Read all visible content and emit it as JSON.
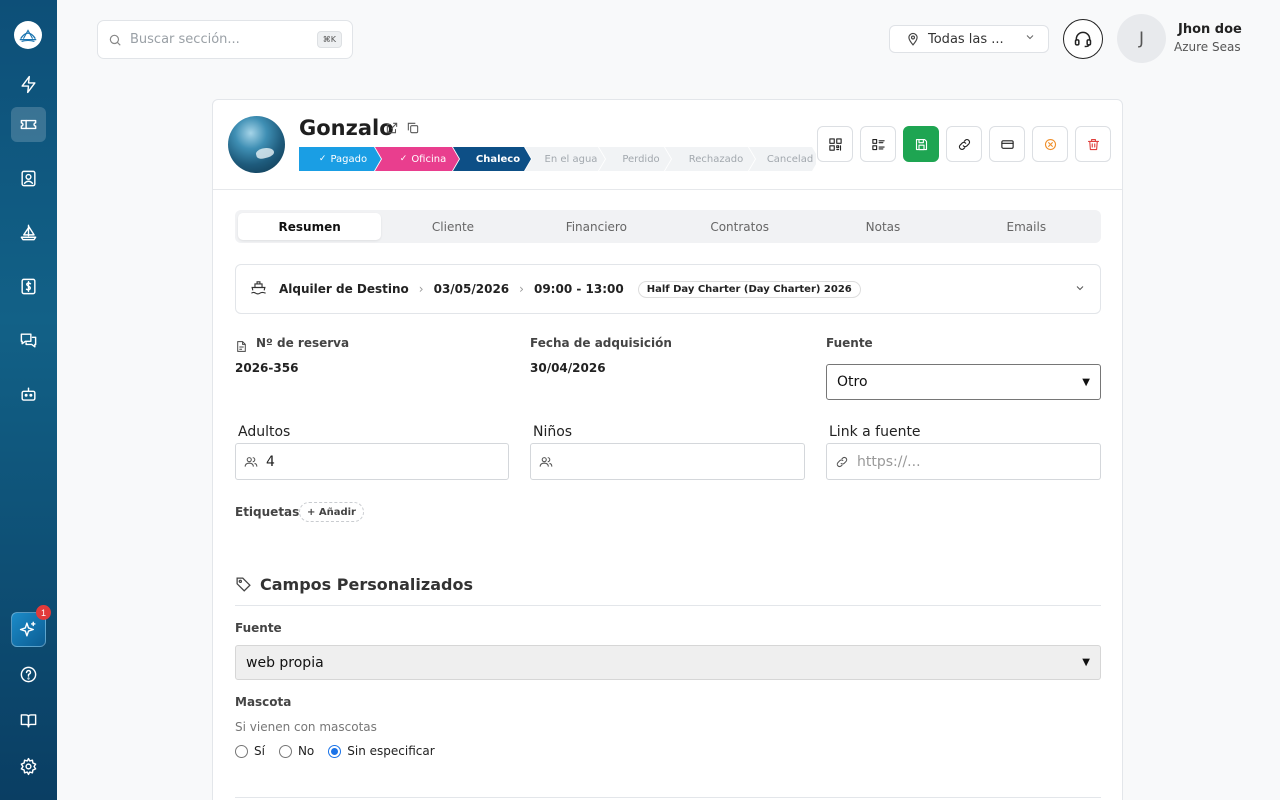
{
  "search": {
    "placeholder": "Buscar sección...",
    "shortcut": "⌘K"
  },
  "location": {
    "label": "Todas las ..."
  },
  "user": {
    "initial": "J",
    "name": "Jhon doe",
    "org": "Azure Seas"
  },
  "sidebar": {
    "badge": "1"
  },
  "booking": {
    "name": "Gonzalo",
    "stages": [
      {
        "label": "Pagado",
        "state": "done",
        "check": "✓"
      },
      {
        "label": "Oficina",
        "state": "done",
        "check": "✓"
      },
      {
        "label": "Chaleco",
        "state": "current"
      },
      {
        "label": "En el agua",
        "state": "todo"
      },
      {
        "label": "Perdido",
        "state": "todo"
      },
      {
        "label": "Rechazado",
        "state": "todo"
      },
      {
        "label": "Cancelad",
        "state": "todo"
      }
    ]
  },
  "tabs": [
    "Resumen",
    "Cliente",
    "Financiero",
    "Contratos",
    "Notas",
    "Emails"
  ],
  "trip": {
    "type": "Alquiler de Destino",
    "date": "03/05/2026",
    "time": "09:00 - 13:00",
    "product": "Half Day Charter (Day Charter) 2026"
  },
  "fields": {
    "reserva_label": "Nº de reserva",
    "reserva_value": "2026-356",
    "fecha_label": "Fecha de adquisición",
    "fecha_value": "30/04/2026",
    "fuente_label": "Fuente",
    "fuente_value": "Otro",
    "adultos_label": "Adultos",
    "adultos_value": "4",
    "ninos_label": "Niños",
    "ninos_value": "",
    "link_label": "Link a fuente",
    "link_placeholder": "https://...",
    "etiquetas_label": "Etiquetas",
    "add_tag": "+ Añadir"
  },
  "custom": {
    "title": "Campos Personalizados",
    "fuente_label": "Fuente",
    "fuente_value": "web propia",
    "mascota_label": "Mascota",
    "mascota_help": "Si vienen con mascotas",
    "options": [
      "Sí",
      "No",
      "Sin especificar"
    ],
    "selected": 2
  }
}
